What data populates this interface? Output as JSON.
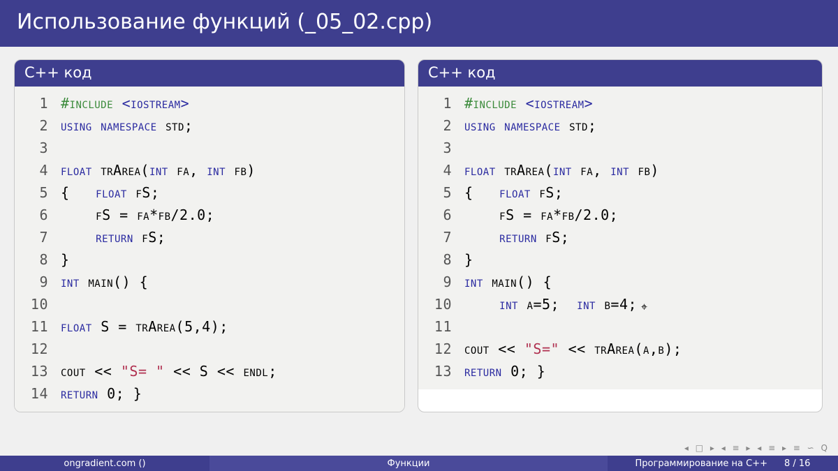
{
  "slide": {
    "title": "Использование функций (_05_02.cpp)"
  },
  "left": {
    "title": "C++ код",
    "lines": [
      {
        "n": "1",
        "tokens": [
          {
            "c": "pp",
            "t": "#include "
          },
          {
            "c": "inc",
            "t": "<iostream>"
          }
        ]
      },
      {
        "n": "2",
        "tokens": [
          {
            "c": "kw",
            "t": "using namespace"
          },
          {
            "c": "txt",
            "t": " std;"
          }
        ]
      },
      {
        "n": "3",
        "tokens": [
          {
            "c": "txt",
            "t": ""
          }
        ]
      },
      {
        "n": "4",
        "tokens": [
          {
            "c": "ty",
            "t": "float"
          },
          {
            "c": "txt",
            "t": " trArea("
          },
          {
            "c": "ty",
            "t": "int"
          },
          {
            "c": "txt",
            "t": " fa, "
          },
          {
            "c": "ty",
            "t": "int"
          },
          {
            "c": "txt",
            "t": " fb)"
          }
        ]
      },
      {
        "n": "5",
        "tokens": [
          {
            "c": "txt",
            "t": "{   "
          },
          {
            "c": "ty",
            "t": "float"
          },
          {
            "c": "txt",
            "t": " fS;"
          }
        ]
      },
      {
        "n": "6",
        "tokens": [
          {
            "c": "txt",
            "t": "    fS = fa*fb/2.0;"
          }
        ]
      },
      {
        "n": "7",
        "tokens": [
          {
            "c": "txt",
            "t": "    "
          },
          {
            "c": "kw",
            "t": "return"
          },
          {
            "c": "txt",
            "t": " fS;"
          }
        ]
      },
      {
        "n": "8",
        "tokens": [
          {
            "c": "txt",
            "t": "}"
          }
        ]
      },
      {
        "n": "9",
        "tokens": [
          {
            "c": "ty",
            "t": "int"
          },
          {
            "c": "txt",
            "t": " main() {"
          }
        ]
      },
      {
        "n": "10",
        "tokens": [
          {
            "c": "txt",
            "t": ""
          }
        ]
      },
      {
        "n": "11",
        "tokens": [
          {
            "c": "ty",
            "t": "float"
          },
          {
            "c": "txt",
            "t": " S = trArea(5,4);"
          }
        ]
      },
      {
        "n": "12",
        "tokens": [
          {
            "c": "txt",
            "t": ""
          }
        ]
      },
      {
        "n": "13",
        "tokens": [
          {
            "c": "txt",
            "t": "cout << "
          },
          {
            "c": "str",
            "t": "\"S= \""
          },
          {
            "c": "txt",
            "t": " << S << endl;"
          }
        ]
      },
      {
        "n": "14",
        "tokens": [
          {
            "c": "kw",
            "t": "return"
          },
          {
            "c": "txt",
            "t": " 0; }"
          }
        ]
      }
    ]
  },
  "right": {
    "title": "C++ код",
    "lines": [
      {
        "n": "1",
        "tokens": [
          {
            "c": "pp",
            "t": "#include "
          },
          {
            "c": "inc",
            "t": "<iostream>"
          }
        ]
      },
      {
        "n": "2",
        "tokens": [
          {
            "c": "kw",
            "t": "using namespace"
          },
          {
            "c": "txt",
            "t": " std;"
          }
        ]
      },
      {
        "n": "3",
        "tokens": [
          {
            "c": "txt",
            "t": ""
          }
        ]
      },
      {
        "n": "4",
        "tokens": [
          {
            "c": "ty",
            "t": "float"
          },
          {
            "c": "txt",
            "t": " trArea("
          },
          {
            "c": "ty",
            "t": "int"
          },
          {
            "c": "txt",
            "t": " fa, "
          },
          {
            "c": "ty",
            "t": "int"
          },
          {
            "c": "txt",
            "t": " fb)"
          }
        ]
      },
      {
        "n": "5",
        "tokens": [
          {
            "c": "txt",
            "t": "{   "
          },
          {
            "c": "ty",
            "t": "float"
          },
          {
            "c": "txt",
            "t": " fS;"
          }
        ]
      },
      {
        "n": "6",
        "tokens": [
          {
            "c": "txt",
            "t": "    fS = fa*fb/2.0;"
          }
        ]
      },
      {
        "n": "7",
        "tokens": [
          {
            "c": "txt",
            "t": "    "
          },
          {
            "c": "kw",
            "t": "return"
          },
          {
            "c": "txt",
            "t": " fS;"
          }
        ]
      },
      {
        "n": "8",
        "tokens": [
          {
            "c": "txt",
            "t": "}"
          }
        ]
      },
      {
        "n": "9",
        "tokens": [
          {
            "c": "ty",
            "t": "int"
          },
          {
            "c": "txt",
            "t": " main() {"
          }
        ]
      },
      {
        "n": "10",
        "tokens": [
          {
            "c": "txt",
            "t": "    "
          },
          {
            "c": "ty",
            "t": "int"
          },
          {
            "c": "txt",
            "t": " a=5;  "
          },
          {
            "c": "ty",
            "t": "int"
          },
          {
            "c": "txt",
            "t": " b=4;"
          }
        ]
      },
      {
        "n": "11",
        "tokens": [
          {
            "c": "txt",
            "t": ""
          }
        ]
      },
      {
        "n": "12",
        "tokens": [
          {
            "c": "txt",
            "t": "cout << "
          },
          {
            "c": "str",
            "t": "\"S=\""
          },
          {
            "c": "txt",
            "t": " << trArea(a,b);"
          }
        ]
      },
      {
        "n": "13",
        "tokens": [
          {
            "c": "kw",
            "t": "return"
          },
          {
            "c": "txt",
            "t": " 0; }"
          }
        ]
      }
    ]
  },
  "footer": {
    "left": "ongradient.com ()",
    "center": "Функции",
    "right": "Программирование на C++",
    "page": "8 / 16"
  },
  "nav_symbols": "◂ □ ▸ ◂ ≡ ▸ ◂ ≡ ▸ ≡  ∽ Q"
}
